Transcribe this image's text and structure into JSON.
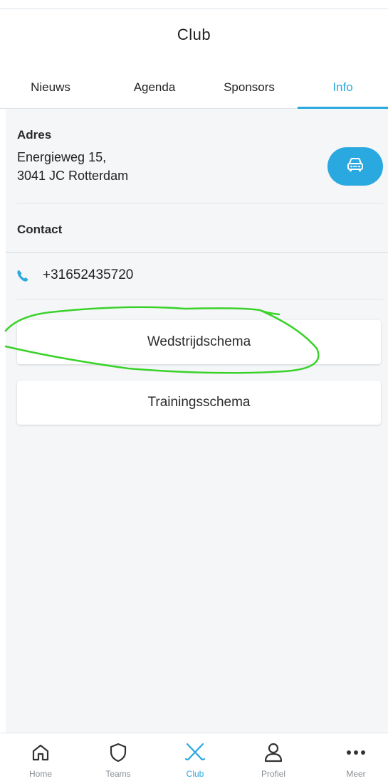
{
  "header": {
    "title": "Club"
  },
  "tabs": [
    {
      "label": "Nieuws",
      "active": false
    },
    {
      "label": "Agenda",
      "active": false
    },
    {
      "label": "Sponsors",
      "active": false
    },
    {
      "label": "Info",
      "active": true
    }
  ],
  "address": {
    "label": "Adres",
    "line1": "Energieweg 15,",
    "line2": "3041 JC Rotterdam",
    "route_button_icon": "car-icon"
  },
  "contact": {
    "label": "Contact",
    "phone_icon": "phone-icon",
    "phone": "+31652435720"
  },
  "buttons": {
    "match_schedule": "Wedstrijdschema",
    "training_schedule": "Trainingsschema"
  },
  "annotation": {
    "color": "#3ad22a",
    "shape": "hand-drawn circle around Wedstrijdschema"
  },
  "bottom_nav": [
    {
      "label": "Home",
      "icon": "home-icon",
      "active": false
    },
    {
      "label": "Teams",
      "icon": "shield-icon",
      "active": false
    },
    {
      "label": "Club",
      "icon": "hockey-sticks-icon",
      "active": true
    },
    {
      "label": "Profiel",
      "icon": "user-icon",
      "active": false
    },
    {
      "label": "Meer",
      "icon": "more-dots-icon",
      "active": false
    }
  ],
  "colors": {
    "accent": "#2aa8e0",
    "background": "#f4f6f8",
    "inactive_nav": "#8a8f94"
  }
}
